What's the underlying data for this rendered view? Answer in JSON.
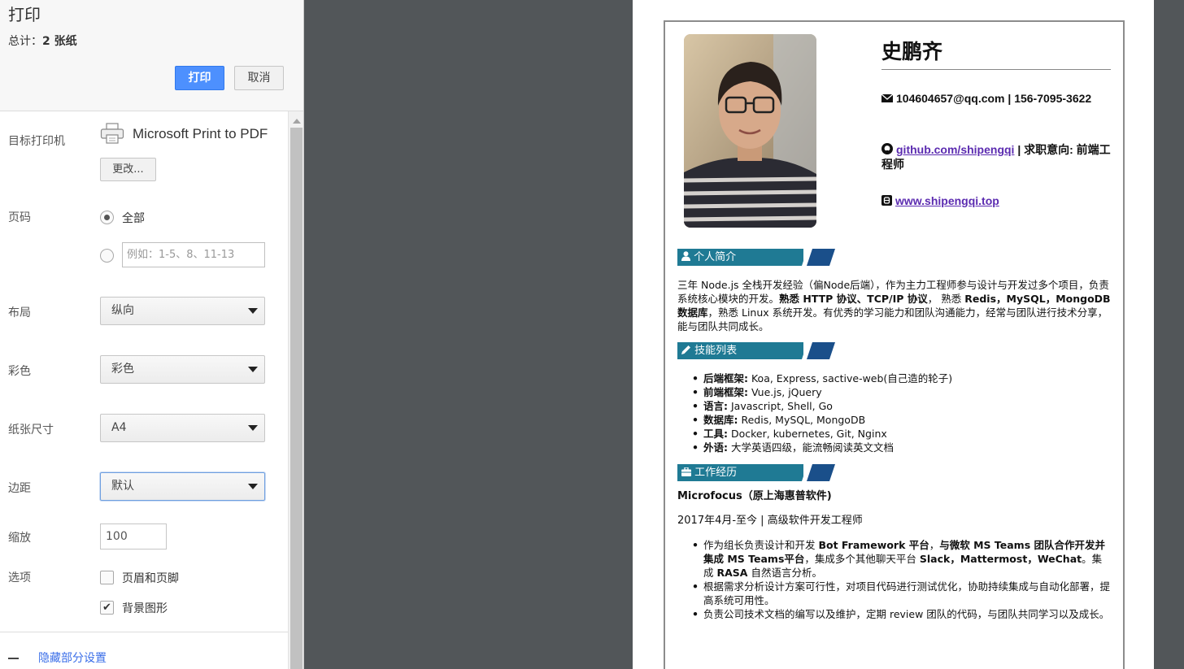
{
  "print_panel": {
    "title": "打印",
    "total_label": "总计：",
    "total_value": "2 张纸",
    "print_button": "打印",
    "cancel_button": "取消",
    "destination": {
      "label": "目标打印机",
      "printer": "Microsoft Print to PDF",
      "change_button": "更改..."
    },
    "pages": {
      "label": "页码",
      "option_all": "全部",
      "custom_placeholder": "例如：1-5、8、11-13",
      "selected": "全部"
    },
    "layout": {
      "label": "布局",
      "value": "纵向"
    },
    "color": {
      "label": "彩色",
      "value": "彩色"
    },
    "paper_size": {
      "label": "纸张尺寸",
      "value": "A4"
    },
    "margins": {
      "label": "边距",
      "value": "默认"
    },
    "scale": {
      "label": "缩放",
      "value": "100"
    },
    "options": {
      "label": "选项",
      "header_footer": "页眉和页脚",
      "header_footer_checked": false,
      "background_graphics": "背景图形",
      "background_graphics_checked": true
    },
    "hide_settings": "隐藏部分设置"
  },
  "resume": {
    "name": "史鹏齐",
    "email_phone": "104604657@qq.com | 156-7095-3622",
    "github": "github.com/shipengqi",
    "job_intent": " | 求职意向: 前端工程师",
    "blog": "www.shipengqi.top",
    "sections": {
      "intro_title": "个人简介",
      "skills_title": "技能列表",
      "work_title": "工作经历"
    },
    "intro": {
      "p1": "三年 Node.js 全栈开发经验（偏Node后端），作为主力工程师参与设计与开发过多个项目，负责系统核心模块的开发。",
      "b1": "熟悉 HTTP 协议、TCP/IP 协议",
      "p2": "， 熟悉 ",
      "b2": "Redis，MySQL，MongoDB 数据库",
      "p3": "，熟悉 Linux 系统开发。有优秀的学习能力和团队沟通能力，经常与团队进行技术分享，能与团队共同成长。"
    },
    "skills": [
      {
        "k": "后端框架:",
        "v": " Koa, Express, sactive-web(自己造的轮子)"
      },
      {
        "k": "前端框架:",
        "v": " Vue.js, jQuery"
      },
      {
        "k": "语言:",
        "v": " Javascript, Shell, Go"
      },
      {
        "k": "数据库:",
        "v": " Redis, MySQL, MongoDB"
      },
      {
        "k": "工具:",
        "v": " Docker, kubernetes, Git, Nginx"
      },
      {
        "k": "外语:",
        "v": " 大学英语四级，能流畅阅读英文文档"
      }
    ],
    "company": "Microfocus（原上海惠普软件)",
    "period_role": "2017年4月-至今 | 高级软件开发工程师",
    "work_items": {
      "w1_a": "作为组长负责设计和开发 ",
      "w1_b": "Bot Framework 平台",
      "w1_c": "，",
      "w1_d": "与微软 MS Teams 团队合作开发并集成 MS Teams平台",
      "w1_e": "，集成多个其他聊天平台 ",
      "w1_f": "Slack，Mattermost，WeChat",
      "w1_g": "。集成 ",
      "w1_h": "RASA",
      "w1_i": " 自然语言分析。",
      "w2": "根据需求分析设计方案可行性，对项目代码进行测试优化，协助持续集成与自动化部署，提高系统可用性。",
      "w3": "负责公司技术文档的编写以及维护，定期 review 团队的代码，与团队共同学习以及成长。"
    }
  },
  "colors": {
    "accent": "#1f7a94",
    "stripe": "#1a4f8a",
    "primary_button": "#4d90fe",
    "link": "#5b2bb0"
  }
}
